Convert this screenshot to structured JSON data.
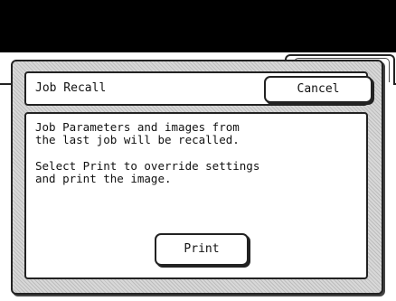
{
  "dialog": {
    "title": "Job Recall",
    "cancel_label": "Cancel",
    "message_line1": "Job Parameters and images from",
    "message_line2": "the last job will be recalled.",
    "message_line3": "Select Print to override settings",
    "message_line4": "and print the image.",
    "print_label": "Print"
  }
}
